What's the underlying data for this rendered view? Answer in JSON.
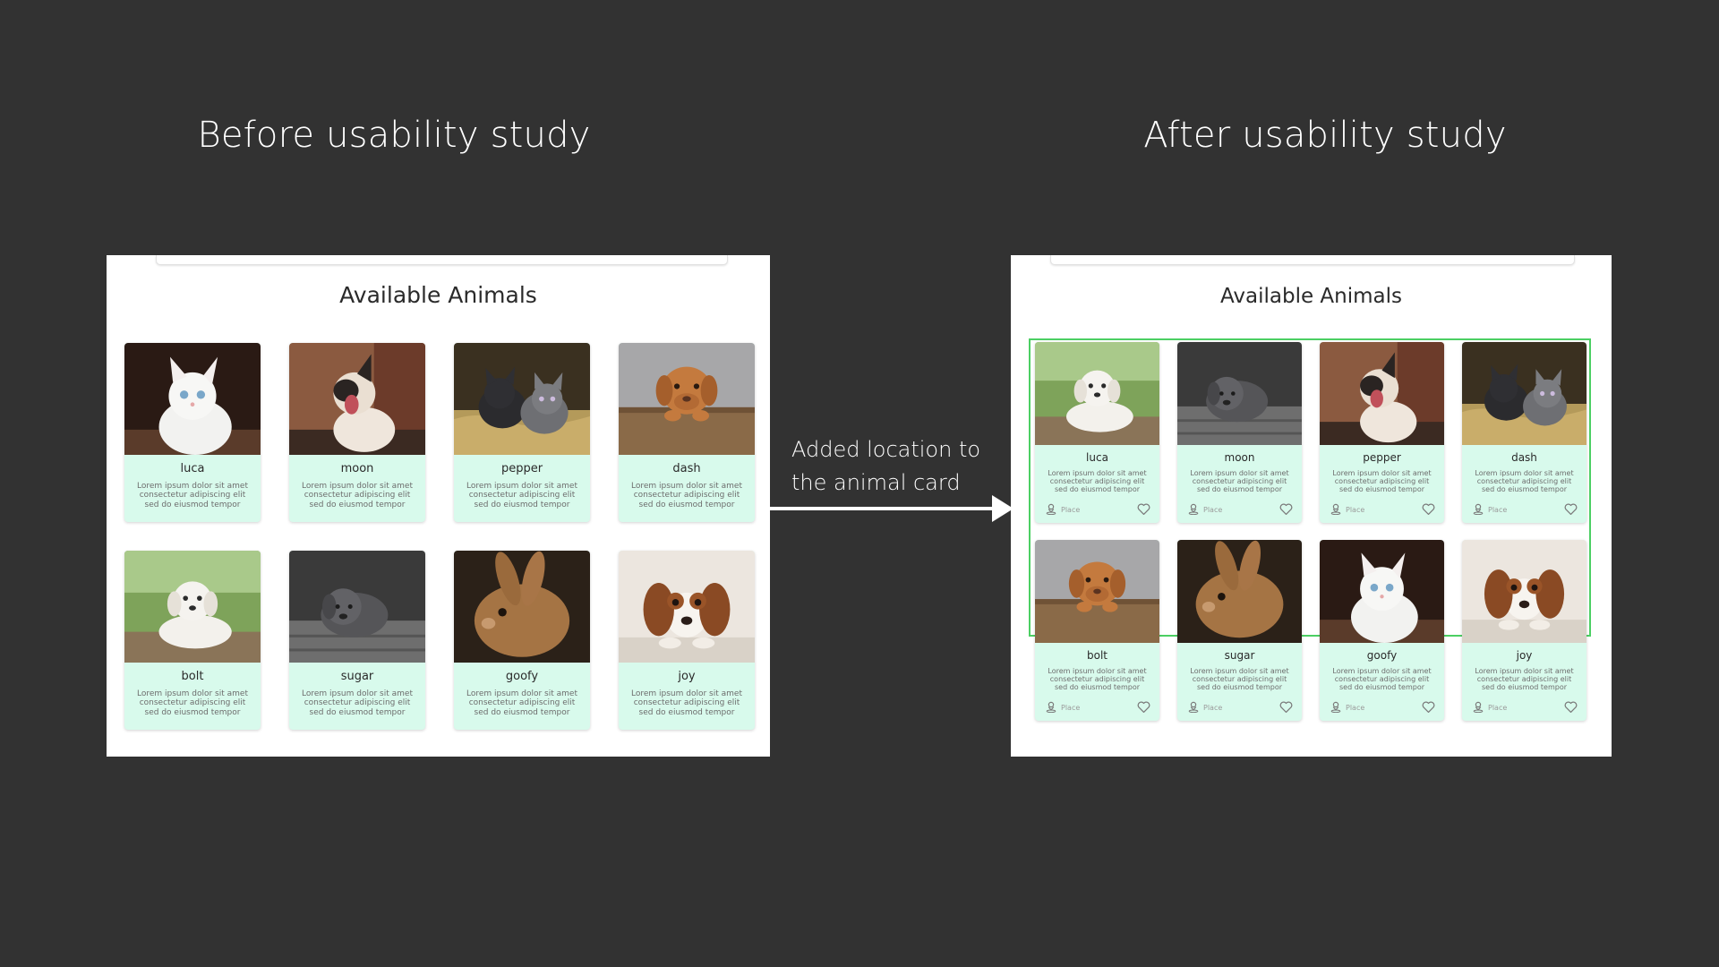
{
  "headings": {
    "before": "Before usability study",
    "after": "After usability study"
  },
  "annotation": "Added location to the animal card",
  "colors": {
    "background": "#323232",
    "panel": "#ffffff",
    "card": "#d8faec",
    "highlight_border": "#4ccf63",
    "arrow": "#ffffff"
  },
  "before_screen": {
    "title": "Available Animals",
    "cards": [
      {
        "name": "luca",
        "photo": "white-kitten",
        "description": "Lorem ipsum dolor sit amet consectetur adipiscing elit sed do eiusmod tempor"
      },
      {
        "name": "moon",
        "photo": "yawning-kitten",
        "description": "Lorem ipsum dolor sit amet consectetur adipiscing elit sed do eiusmod tempor"
      },
      {
        "name": "pepper",
        "photo": "two-kittens",
        "description": "Lorem ipsum dolor sit amet consectetur adipiscing elit sed do eiusmod tempor"
      },
      {
        "name": "dash",
        "photo": "brown-puppy",
        "description": "Lorem ipsum dolor sit amet consectetur adipiscing elit sed do eiusmod tempor"
      },
      {
        "name": "bolt",
        "photo": "white-puppy",
        "description": "Lorem ipsum dolor sit amet consectetur adipiscing elit sed do eiusmod tempor"
      },
      {
        "name": "sugar",
        "photo": "gray-puppy",
        "description": "Lorem ipsum dolor sit amet consectetur adipiscing elit sed do eiusmod tempor"
      },
      {
        "name": "goofy",
        "photo": "rabbit",
        "description": "Lorem ipsum dolor sit amet consectetur adipiscing elit sed do eiusmod tempor"
      },
      {
        "name": "joy",
        "photo": "spaniel",
        "description": "Lorem ipsum dolor sit amet consectetur adipiscing elit sed do eiusmod tempor"
      }
    ]
  },
  "after_screen": {
    "title": "Available Animals",
    "cards": [
      {
        "name": "luca",
        "photo": "white-puppy",
        "description": "Lorem ipsum dolor sit amet consectetur adipiscing elit sed do eiusmod tempor",
        "location": "Place",
        "icons": [
          "person-pin-icon",
          "heart-icon"
        ]
      },
      {
        "name": "moon",
        "photo": "gray-puppy",
        "description": "Lorem ipsum dolor sit amet consectetur adipiscing elit sed do eiusmod tempor",
        "location": "Place",
        "icons": [
          "person-pin-icon",
          "heart-icon"
        ]
      },
      {
        "name": "pepper",
        "photo": "yawning-kitten",
        "description": "Lorem ipsum dolor sit amet consectetur adipiscing elit sed do eiusmod tempor",
        "location": "Place",
        "icons": [
          "person-pin-icon",
          "heart-icon"
        ]
      },
      {
        "name": "dash",
        "photo": "two-kittens",
        "description": "Lorem ipsum dolor sit amet consectetur adipiscing elit sed do eiusmod tempor",
        "location": "Place",
        "icons": [
          "person-pin-icon",
          "heart-icon"
        ]
      },
      {
        "name": "bolt",
        "photo": "brown-puppy",
        "description": "Lorem ipsum dolor sit amet consectetur adipiscing elit sed do eiusmod tempor",
        "location": "Place",
        "icons": [
          "person-pin-icon",
          "heart-icon"
        ]
      },
      {
        "name": "sugar",
        "photo": "rabbit",
        "description": "Lorem ipsum dolor sit amet consectetur adipiscing elit sed do eiusmod tempor",
        "location": "Place",
        "icons": [
          "person-pin-icon",
          "heart-icon"
        ]
      },
      {
        "name": "goofy",
        "photo": "white-kitten",
        "description": "Lorem ipsum dolor sit amet consectetur adipiscing elit sed do eiusmod tempor",
        "location": "Place",
        "icons": [
          "person-pin-icon",
          "heart-icon"
        ]
      },
      {
        "name": "joy",
        "photo": "spaniel",
        "description": "Lorem ipsum dolor sit amet consectetur adipiscing elit sed do eiusmod tempor",
        "location": "Place",
        "icons": [
          "person-pin-icon",
          "heart-icon"
        ]
      }
    ]
  }
}
